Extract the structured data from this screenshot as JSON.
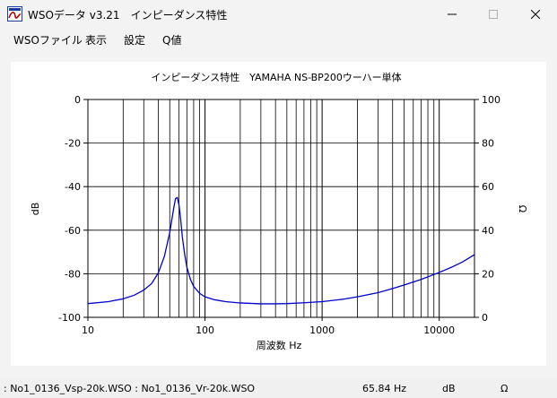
{
  "window": {
    "title": "WSOデータ v3.21　インピーダンス特性"
  },
  "menu": {
    "items": [
      "WSOファイル",
      "表示",
      "設定",
      "Q値"
    ]
  },
  "status": {
    "files": ": No1_0136_Vsp-20k.WSO : No1_0136_Vr-20k.WSO",
    "frequency": "65.84 Hz",
    "left_unit": "dB",
    "right_unit": "Ω"
  },
  "colors": {
    "curve": "#0000cc",
    "grid": "#000000",
    "panel": "#ffffff"
  },
  "chart_data": {
    "type": "line",
    "title": "インピーダンス特性　YAMAHA NS-BP200ウーハー単体",
    "xlabel": "周波数 Hz",
    "ylabel": "dB",
    "y2label": "Ω",
    "xscale": "log",
    "xlim": [
      10,
      20000
    ],
    "ylim": [
      -100,
      0
    ],
    "y2lim": [
      0,
      100
    ],
    "xticks": [
      10,
      100,
      1000,
      10000
    ],
    "xtick_labels": [
      "10",
      "100",
      "1000",
      "10000"
    ],
    "yticks": [
      0,
      -20,
      -40,
      -60,
      -80,
      -100
    ],
    "ytick_labels": [
      "0",
      "-20",
      "-40",
      "-60",
      "-80",
      "-100"
    ],
    "y2ticks": [
      100,
      80,
      60,
      40,
      20,
      0
    ],
    "y2tick_labels": [
      "100",
      "80",
      "60",
      "40",
      "20",
      "0"
    ],
    "grid": true,
    "series": [
      {
        "x": [
          10,
          15,
          20,
          25,
          30,
          35,
          40,
          45,
          50,
          54,
          56,
          58,
          60,
          62,
          64,
          67,
          70,
          75,
          80,
          90,
          100,
          120,
          150,
          200,
          300,
          400,
          500,
          700,
          1000,
          1500,
          2000,
          3000,
          4000,
          5000,
          7000,
          10000,
          13000,
          16000,
          20000
        ],
        "y": [
          6.3,
          7.2,
          8.5,
          10.2,
          12.5,
          15.5,
          20.5,
          28,
          39,
          50,
          54.5,
          55,
          51.5,
          45,
          37,
          29,
          23,
          17.5,
          14.2,
          11,
          9.4,
          8.1,
          7.2,
          6.6,
          6.2,
          6.2,
          6.3,
          6.7,
          7.2,
          8.3,
          9.4,
          11.3,
          13.2,
          14.8,
          17.4,
          20.6,
          23.2,
          25.6,
          28.8
        ]
      }
    ]
  }
}
